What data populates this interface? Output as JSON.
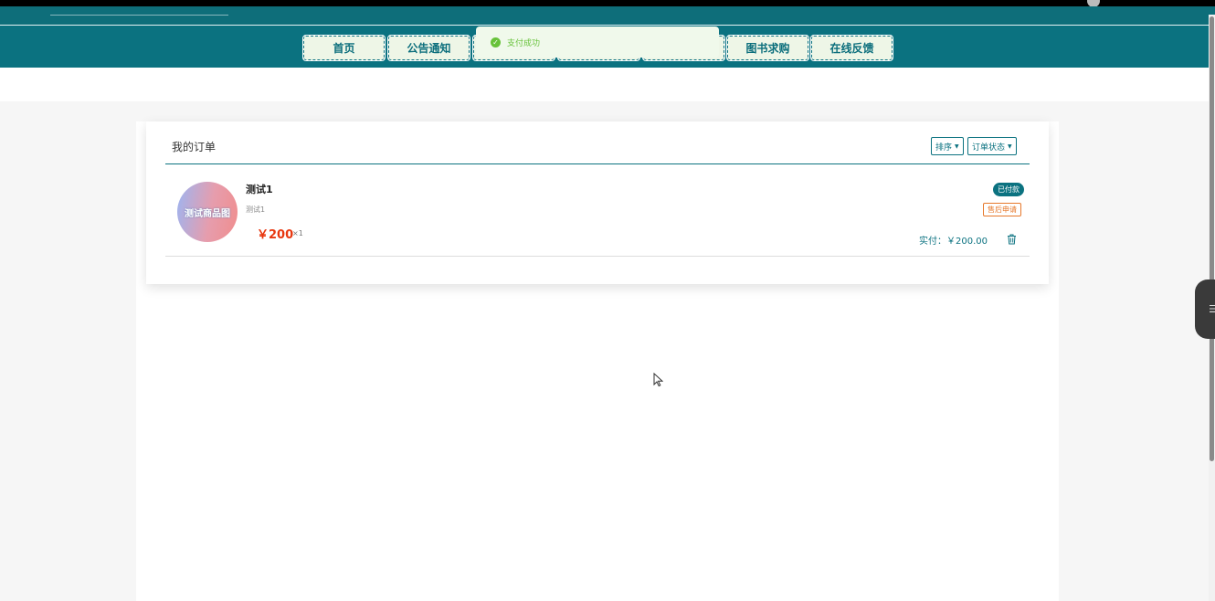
{
  "nav": {
    "items": [
      "首页",
      "公告通知",
      "",
      "",
      "图书求购",
      "在线反馈"
    ]
  },
  "toast": {
    "message": "支付成功",
    "icon": "check-circle-icon",
    "color": "#67c23a"
  },
  "orders_panel": {
    "title": "我的订单",
    "sort_label": "排序",
    "status_label": "订单状态"
  },
  "order": {
    "thumbnail_text": "测试商品图",
    "name": "测试1",
    "description": "测试1",
    "price": "￥200",
    "quantity": "×1",
    "status_badge": "已付款",
    "after_sale_label": "售后申请",
    "paid_total": "实付：￥200.00",
    "delete_icon": "trash-icon"
  },
  "colors": {
    "brand": "#0b7280",
    "price": "#e8370f",
    "after_sale": "#e6782b"
  }
}
